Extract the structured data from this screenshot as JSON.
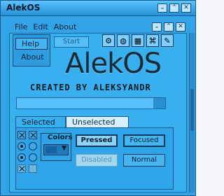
{
  "window": {
    "title": "AlekOS",
    "controls": [
      "minimize",
      "maximize",
      "close"
    ]
  },
  "menu": {
    "items": [
      "File",
      "Edit",
      "About"
    ],
    "mdi_controls": [
      "minimize",
      "restore",
      "close"
    ]
  },
  "popup_menu": {
    "items": [
      "Help",
      "About"
    ]
  },
  "toolbar": {
    "start_label": "Start",
    "icons": [
      "settings-icon",
      "globe-icon",
      "pictures-icon",
      "network-icon",
      "tools-icon"
    ]
  },
  "logo": {
    "text": "AlekOS",
    "credit": "CREATED BY ALEKSYANDR"
  },
  "progress": {
    "value": 0.92
  },
  "tabs": [
    {
      "label": "Selected",
      "active": true
    },
    {
      "label": "Unselected",
      "active": false
    }
  ],
  "colors_panel": {
    "label": "Colors",
    "selected_swatch": "#1463a0"
  },
  "buttons": {
    "pressed": "Pressed",
    "focused": "Focused",
    "disabled": "Disabled",
    "normal": "Normal"
  },
  "theme": {
    "window_bg": "#32a3e7",
    "titlebar": "#2590d8",
    "dark_text": "#0b1e33"
  }
}
